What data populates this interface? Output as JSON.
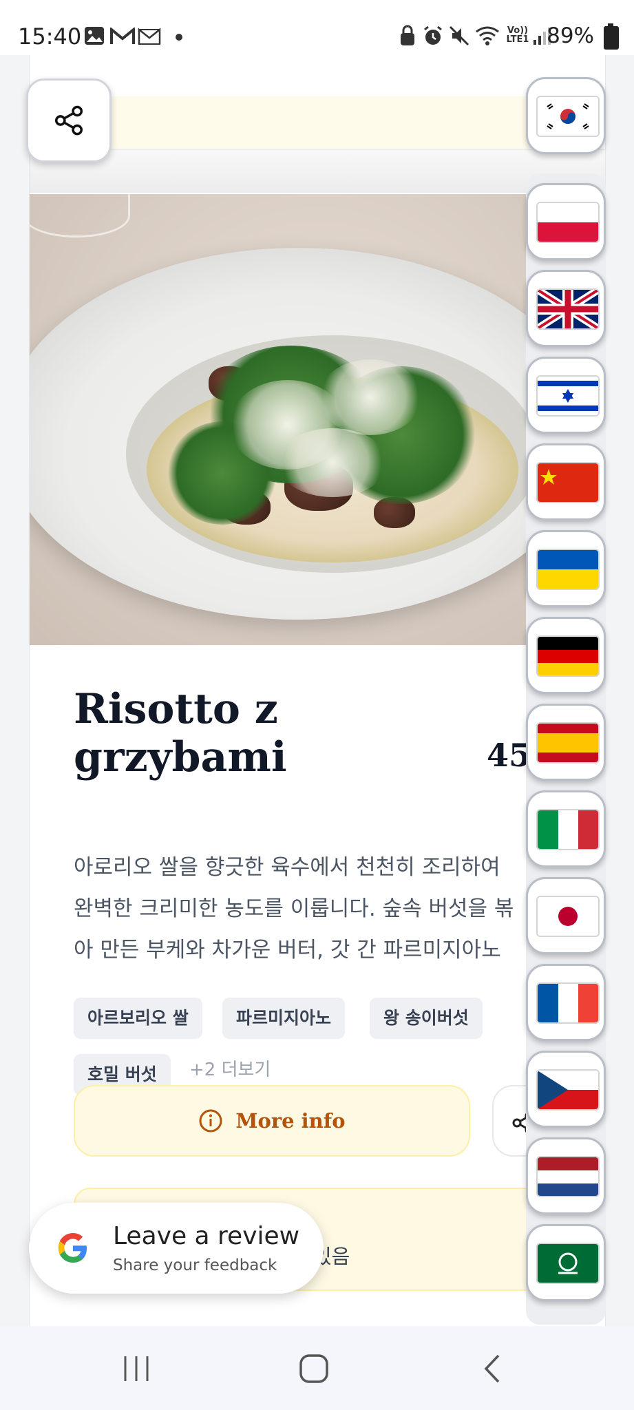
{
  "status_bar": {
    "time": "15:40",
    "battery": "89%",
    "icons": [
      "gallery-icon",
      "gmail-icon",
      "gmail-outline-icon",
      "dot-icon",
      "lock-icon",
      "alarm-icon",
      "mute-icon",
      "wifi-icon",
      "volte-icon",
      "signal-icon",
      "battery-icon"
    ],
    "volte_text": "Vo)) LTE1"
  },
  "dish": {
    "name": "Risotto z grzybami",
    "price": "45 zł",
    "description_lines": [
      "아로리오 쌀을 향긋한 육수에서 천천히 조리하여",
      "완벽한 크리미한 농도를 이룹니다. 숲속 버섯을 볶",
      "아 만든 부케와 차가운 버터, 갓 간 파르미지아노"
    ],
    "tags": [
      "아르보리오 쌀",
      "파르미지아노",
      "왕 송이버섯",
      "호밀 버섯"
    ],
    "more_tags": "+2 더보기",
    "more_info_label": "More info",
    "bottom_text": "있음"
  },
  "review": {
    "title": "Leave a review",
    "subtitle": "Share your feedback"
  },
  "languages": [
    {
      "code": "ko",
      "icon": "flag-korea-icon"
    },
    {
      "code": "pl",
      "icon": "flag-poland-icon"
    },
    {
      "code": "en",
      "icon": "flag-uk-icon"
    },
    {
      "code": "he",
      "icon": "flag-israel-icon"
    },
    {
      "code": "zh",
      "icon": "flag-china-icon"
    },
    {
      "code": "uk",
      "icon": "flag-ukraine-icon"
    },
    {
      "code": "de",
      "icon": "flag-germany-icon"
    },
    {
      "code": "es",
      "icon": "flag-spain-icon"
    },
    {
      "code": "it",
      "icon": "flag-italy-icon"
    },
    {
      "code": "ja",
      "icon": "flag-japan-icon"
    },
    {
      "code": "fr",
      "icon": "flag-france-icon"
    },
    {
      "code": "cs",
      "icon": "flag-czech-icon"
    },
    {
      "code": "nl",
      "icon": "flag-netherlands-icon"
    },
    {
      "code": "ar",
      "icon": "flag-saudi-icon"
    }
  ],
  "nav": {
    "icons": [
      "recents-icon",
      "home-icon",
      "back-icon"
    ]
  },
  "colors": {
    "accent_amber": "#b45309",
    "cream": "#fef9e3",
    "text_dark": "#111827",
    "text_muted": "#4b5563"
  }
}
